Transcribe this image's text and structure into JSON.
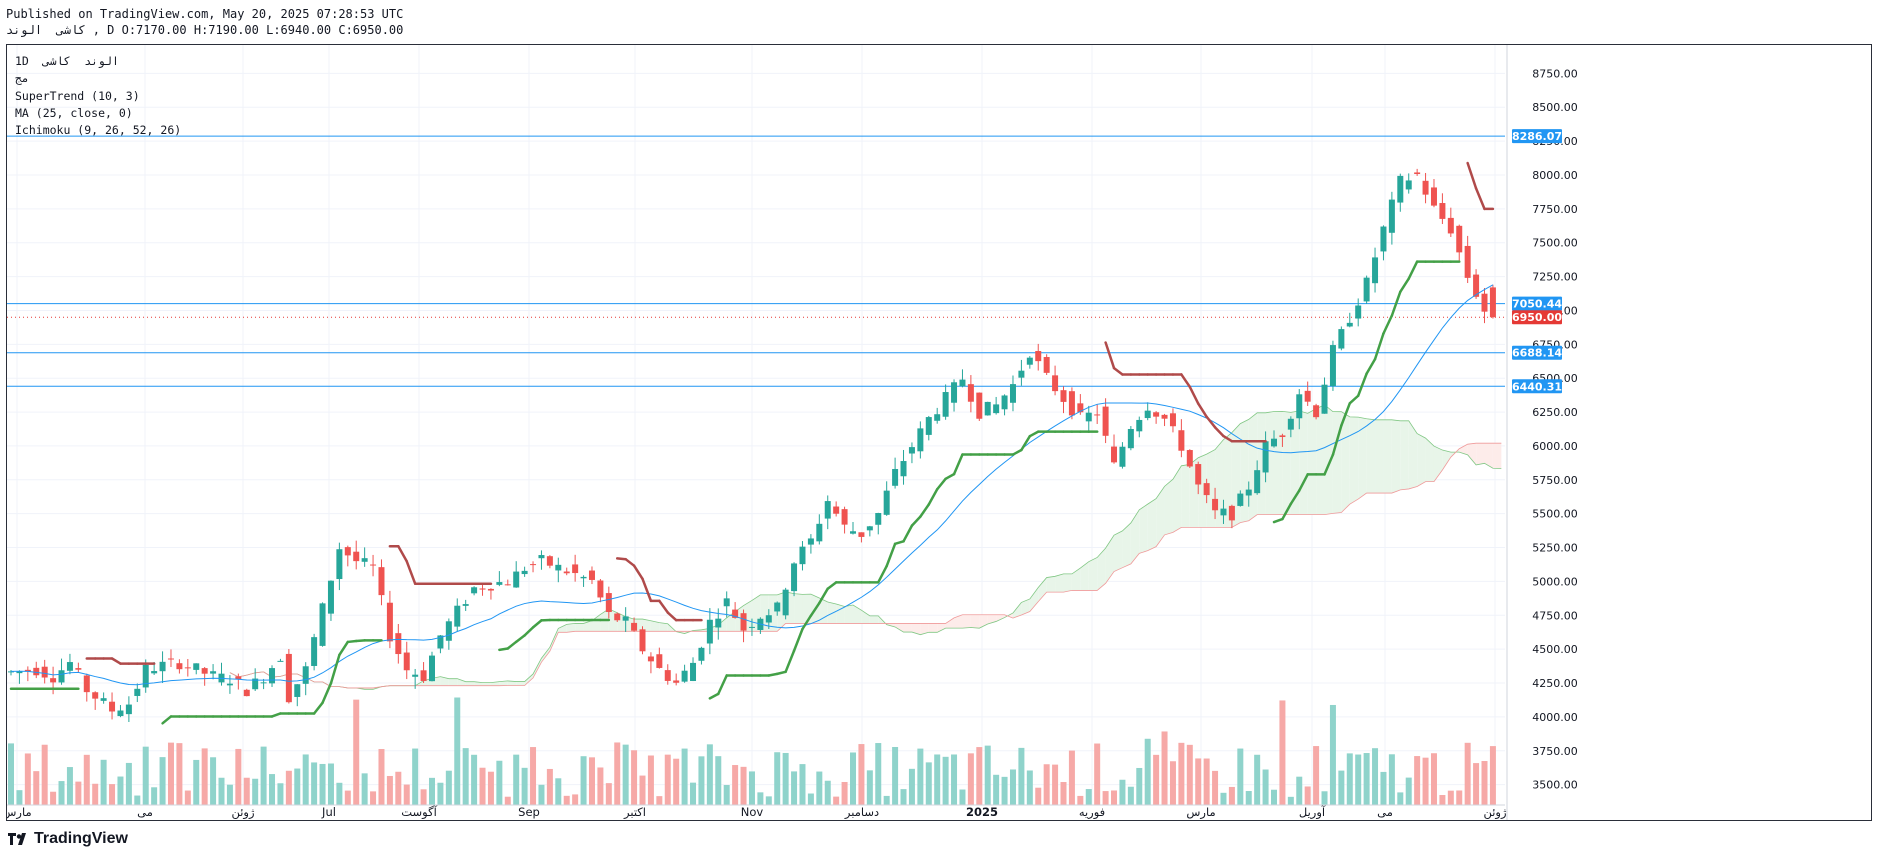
{
  "header": {
    "published": "Published on TradingView.com, May 20, 2025 07:28:53 UTC",
    "ohlc": "کاشی  الوند , D O:7170.00 H:7190.00 L:6940.00 C:6950.00"
  },
  "legend": {
    "symbol": "1D  الوند  کاشی",
    "subtitle": "مج",
    "supertrend": "SuperTrend (10, 3)",
    "ma": "MA (25, close, 0)",
    "ichimoku": "Ichimoku (9, 26, 52, 26)"
  },
  "footer": {
    "logo_text": "TradingView"
  },
  "colors": {
    "up": "#26a69a",
    "down": "#ef5350",
    "st_up": "#43a047",
    "st_down": "#b04a4a",
    "ma": "#2196f3",
    "hline": "#2196f3",
    "last": "#e53935",
    "cloud_up": "#e8f5e9",
    "cloud_down": "#fdecea",
    "cloud_up_line": "#81c784",
    "cloud_down_line": "#ef9a9a"
  },
  "chart_data": {
    "type": "candlestick",
    "symbol": "کاشی الوند",
    "interval": "1D",
    "ylim": [
      3350,
      8900
    ],
    "y_ticks": [
      3500,
      3750,
      4000,
      4250,
      4500,
      4750,
      5000,
      5250,
      5500,
      5750,
      6000,
      6250,
      6500,
      6750,
      7000,
      7250,
      7500,
      7750,
      8000,
      8250,
      8500,
      8750
    ],
    "x_labels": [
      "مارس",
      "می",
      "ژوئن",
      "Jul",
      "آگوست",
      "Sep",
      "اکتبر",
      "Nov",
      "دسامبر",
      "2025",
      "فوریه",
      "مارس",
      "آوریل",
      "می",
      "ژوئن"
    ],
    "price_lines": [
      {
        "value": 8286.07,
        "label": "8286.07"
      },
      {
        "value": 7050.44,
        "label": "7050.44"
      },
      {
        "value": 6688.14,
        "label": "6688.14"
      },
      {
        "value": 6440.31,
        "label": "6440.31"
      }
    ],
    "last_price": {
      "value": 6950.0,
      "label": "6950.00"
    },
    "ohlc_last": {
      "open": 7170.0,
      "high": 7190.0,
      "low": 6940.0,
      "close": 6950.0
    },
    "close_anchors": [
      [
        0,
        4330
      ],
      [
        3,
        4350
      ],
      [
        5,
        4300
      ],
      [
        7,
        4400
      ],
      [
        9,
        4200
      ],
      [
        12,
        4050
      ],
      [
        14,
        4100
      ],
      [
        16,
        4350
      ],
      [
        18,
        4380
      ],
      [
        20,
        4400
      ],
      [
        22,
        4350
      ],
      [
        24,
        4300
      ],
      [
        26,
        4280
      ],
      [
        28,
        4200
      ],
      [
        30,
        4300
      ],
      [
        32,
        4450
      ],
      [
        33,
        4150
      ],
      [
        35,
        4350
      ],
      [
        37,
        4800
      ],
      [
        39,
        5250
      ],
      [
        41,
        5150
      ],
      [
        43,
        5100
      ],
      [
        45,
        4600
      ],
      [
        47,
        4350
      ],
      [
        49,
        4300
      ],
      [
        51,
        4600
      ],
      [
        53,
        4780
      ],
      [
        55,
        4950
      ],
      [
        57,
        4980
      ],
      [
        59,
        5000
      ],
      [
        61,
        5100
      ],
      [
        63,
        5150
      ],
      [
        65,
        5100
      ],
      [
        67,
        5050
      ],
      [
        69,
        5000
      ],
      [
        71,
        4750
      ],
      [
        73,
        4700
      ],
      [
        75,
        4500
      ],
      [
        77,
        4350
      ],
      [
        79,
        4250
      ],
      [
        81,
        4400
      ],
      [
        83,
        4700
      ],
      [
        85,
        4850
      ],
      [
        87,
        4650
      ],
      [
        89,
        4750
      ],
      [
        91,
        4800
      ],
      [
        93,
        5150
      ],
      [
        95,
        5300
      ],
      [
        97,
        5600
      ],
      [
        99,
        5400
      ],
      [
        101,
        5350
      ],
      [
        103,
        5500
      ],
      [
        105,
        5800
      ],
      [
        107,
        6000
      ],
      [
        109,
        6200
      ],
      [
        111,
        6350
      ],
      [
        113,
        6500
      ],
      [
        115,
        6250
      ],
      [
        117,
        6300
      ],
      [
        119,
        6450
      ],
      [
        121,
        6700
      ],
      [
        123,
        6500
      ],
      [
        125,
        6350
      ],
      [
        127,
        6200
      ],
      [
        129,
        6250
      ],
      [
        131,
        5850
      ],
      [
        133,
        6150
      ],
      [
        135,
        6300
      ],
      [
        137,
        6200
      ],
      [
        139,
        6000
      ],
      [
        141,
        5700
      ],
      [
        143,
        5500
      ],
      [
        145,
        5500
      ],
      [
        147,
        5700
      ],
      [
        149,
        6000
      ],
      [
        151,
        6100
      ],
      [
        153,
        6400
      ],
      [
        155,
        6250
      ],
      [
        157,
        6700
      ],
      [
        159,
        6950
      ],
      [
        161,
        7200
      ],
      [
        163,
        7600
      ],
      [
        165,
        7950
      ],
      [
        167,
        8000
      ],
      [
        169,
        7750
      ],
      [
        171,
        7600
      ],
      [
        173,
        7250
      ],
      [
        175,
        7000
      ],
      [
        176,
        6950
      ]
    ],
    "volume_scale_note": "volume histogram in lower pane"
  }
}
